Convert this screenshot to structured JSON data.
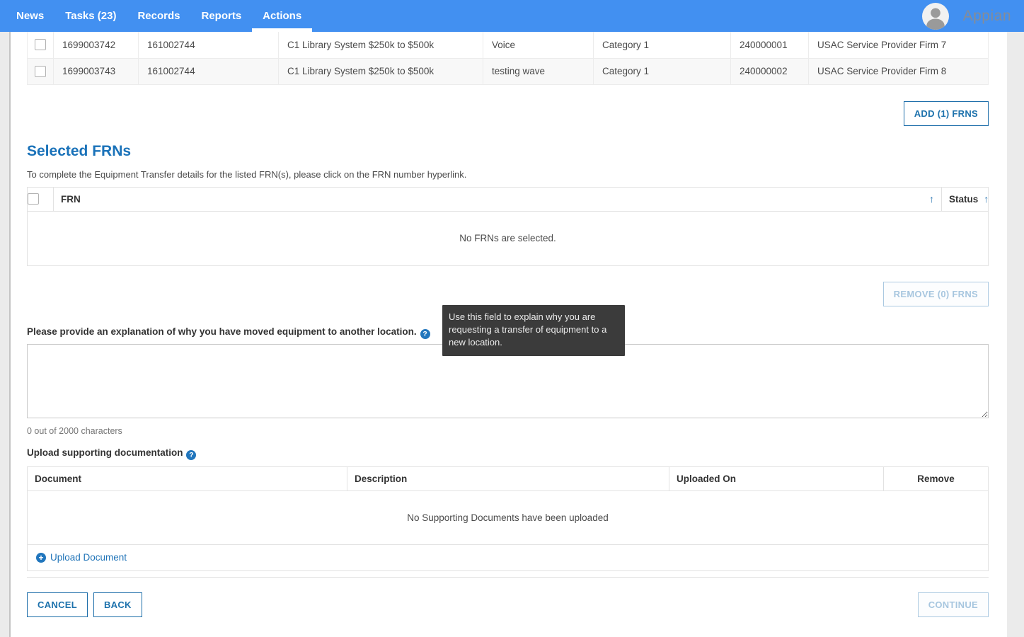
{
  "nav": {
    "items": [
      {
        "label": "News"
      },
      {
        "label": "Tasks (23)"
      },
      {
        "label": "Records"
      },
      {
        "label": "Reports"
      },
      {
        "label": "Actions"
      }
    ],
    "logo_text": "Appian"
  },
  "icons": {
    "sort_ascending": "↑",
    "help": "?",
    "add": "+"
  },
  "colors": {
    "nav_blue": "#4290f1",
    "accent_blue": "#1c71ac",
    "heading_blue": "#1a72b9",
    "disabled_blue": "#a7c6df",
    "tooltip_bg": "#3b3b3b"
  },
  "frn_results": {
    "rows": [
      {
        "frn": "1699003742",
        "application_number": "161002744",
        "nickname": "C1 Library System $250k to $500k",
        "service_type": "Voice",
        "category": "Category 1",
        "spin": "240000001",
        "service_provider": "USAC Service Provider Firm 7"
      },
      {
        "frn": "1699003743",
        "application_number": "161002744",
        "nickname": "C1 Library System $250k to $500k",
        "service_type": "testing wave",
        "category": "Category 1",
        "spin": "240000002",
        "service_provider": "USAC Service Provider Firm 8"
      }
    ],
    "add_button_label": "ADD (1) FRNS"
  },
  "selected_frns": {
    "heading": "Selected FRNs",
    "instruction": "To complete the Equipment Transfer details for the listed FRN(s), please click on the FRN number hyperlink.",
    "frn_column_label": "FRN",
    "status_column_label": "Status",
    "empty_message": "No FRNs are selected.",
    "remove_button_label": "REMOVE (0) FRNS"
  },
  "explanation": {
    "label": "Please provide an explanation of why you have moved equipment to another location.",
    "tooltip": "Use this field to explain why you are requesting a transfer of equipment to a new location.",
    "value": "",
    "char_counter": "0 out of 2000 characters"
  },
  "documents": {
    "label": "Upload supporting documentation",
    "columns": [
      "Document",
      "Description",
      "Uploaded On",
      "Remove"
    ],
    "empty_message": "No Supporting Documents have been uploaded",
    "upload_link_label": "Upload Document"
  },
  "footer": {
    "cancel_label": "CANCEL",
    "back_label": "BACK",
    "continue_label": "CONTINUE"
  }
}
